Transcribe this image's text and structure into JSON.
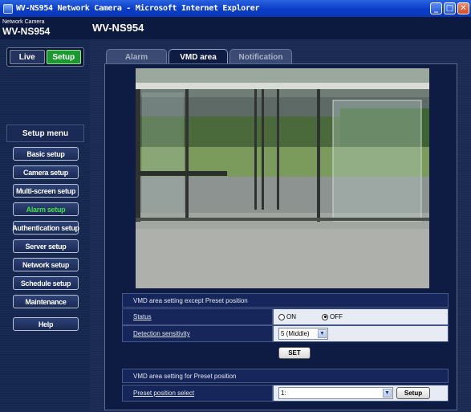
{
  "window": {
    "title": "WV-NS954 Network Camera - Microsoft Internet Explorer",
    "buttons": {
      "minimize": "_",
      "maximize": "□",
      "close": "✕"
    }
  },
  "header": {
    "brand_small": "Network Camera",
    "brand_model": "WV-NS954",
    "model": "WV-NS954"
  },
  "sidebar": {
    "live_label": "Live",
    "setup_label": "Setup",
    "menu_title": "Setup menu",
    "items": [
      {
        "label": "Basic setup",
        "active": false
      },
      {
        "label": "Camera setup",
        "active": false
      },
      {
        "label": "Multi-screen setup",
        "active": false
      },
      {
        "label": "Alarm setup",
        "active": true
      },
      {
        "label": "Authentication setup",
        "active": false
      },
      {
        "label": "Server setup",
        "active": false
      },
      {
        "label": "Network setup",
        "active": false
      },
      {
        "label": "Schedule setup",
        "active": false
      },
      {
        "label": "Maintenance",
        "active": false
      }
    ],
    "help_label": "Help"
  },
  "tabs": [
    {
      "label": "Alarm",
      "active": false
    },
    {
      "label": "VMD area",
      "active": true
    },
    {
      "label": "Notification",
      "active": false
    }
  ],
  "vmd_except": {
    "heading": "VMD area setting except Preset position",
    "status_label": "Status",
    "status_on": "ON",
    "status_off": "OFF",
    "status_value": "OFF",
    "sensitivity_label": "Detection sensitivity",
    "sensitivity_value": "5 (Middle)",
    "set_label": "SET"
  },
  "vmd_preset": {
    "heading": "VMD area setting for Preset position",
    "preset_label": "Preset position select",
    "preset_value": "1:",
    "setup_label": "Setup"
  },
  "colors": {
    "active_green": "#44e04a",
    "setup_green": "#1a9930",
    "navy": "#0e1c44"
  }
}
